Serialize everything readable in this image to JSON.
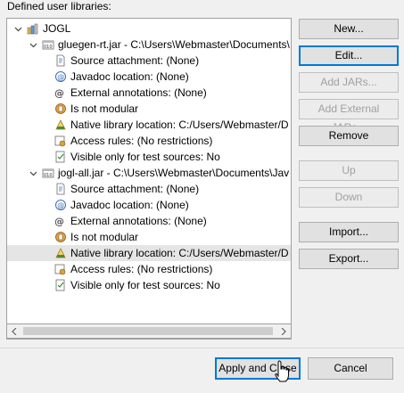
{
  "header": {
    "label": "Defined user libraries:"
  },
  "tree": [
    {
      "kind": "library",
      "expander": "expanded",
      "icon": "library-icon",
      "label": "JOGL"
    },
    {
      "kind": "jar",
      "expander": "expanded",
      "icon": "jar-icon",
      "label": "gluegen-rt.jar - C:\\Users\\Webmaster\\Documents\\"
    },
    {
      "kind": "attr",
      "icon": "source-attachment-icon",
      "label": "Source attachment: (None)"
    },
    {
      "kind": "attr",
      "icon": "javadoc-icon",
      "label": "Javadoc location: (None)"
    },
    {
      "kind": "attr",
      "icon": "external-annotations-icon",
      "label": "External annotations: (None)"
    },
    {
      "kind": "attr",
      "icon": "module-icon",
      "label": "Is not modular"
    },
    {
      "kind": "attr",
      "icon": "native-library-icon",
      "label": "Native library location: C:/Users/Webmaster/D"
    },
    {
      "kind": "attr",
      "icon": "access-rules-icon",
      "label": "Access rules: (No restrictions)"
    },
    {
      "kind": "attr",
      "icon": "test-sources-icon",
      "label": "Visible only for test sources: No"
    },
    {
      "kind": "jar",
      "expander": "expanded",
      "icon": "jar-icon",
      "label": "jogl-all.jar - C:\\Users\\Webmaster\\Documents\\Jav"
    },
    {
      "kind": "attr",
      "icon": "source-attachment-icon",
      "label": "Source attachment: (None)"
    },
    {
      "kind": "attr",
      "icon": "javadoc-icon",
      "label": "Javadoc location: (None)"
    },
    {
      "kind": "attr",
      "icon": "external-annotations-icon",
      "label": "External annotations: (None)"
    },
    {
      "kind": "attr",
      "icon": "module-icon",
      "label": "Is not modular"
    },
    {
      "kind": "attr",
      "icon": "native-library-icon",
      "label": "Native library location: C:/Users/Webmaster/D",
      "selected": true
    },
    {
      "kind": "attr",
      "icon": "access-rules-icon",
      "label": "Access rules: (No restrictions)"
    },
    {
      "kind": "attr",
      "icon": "test-sources-icon",
      "label": "Visible only for test sources: No"
    }
  ],
  "buttons": {
    "new": "New...",
    "edit": "Edit...",
    "add_jars": "Add JARs...",
    "add_external_jars": "Add External JARs...",
    "remove": "Remove",
    "up": "Up",
    "down": "Down",
    "import": "Import...",
    "export": "Export..."
  },
  "dialog": {
    "apply_and_close": "Apply and Close",
    "cancel": "Cancel"
  },
  "colors": {
    "selection": "#e5e5e5",
    "focus": "#0078d7",
    "disabled_text": "#a0a0a0"
  }
}
